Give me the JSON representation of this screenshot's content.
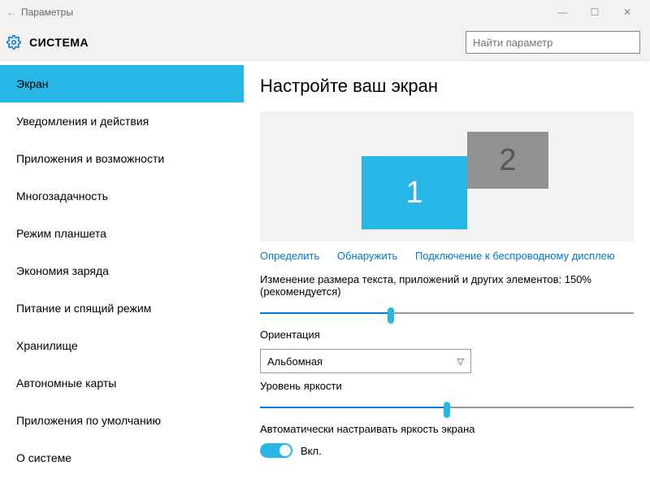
{
  "window": {
    "title": "Параметры",
    "back_icon": "←"
  },
  "header": {
    "title": "СИСТЕМА",
    "search_placeholder": "Найти параметр"
  },
  "sidebar": {
    "items": [
      {
        "label": "Экран",
        "selected": true
      },
      {
        "label": "Уведомления и действия"
      },
      {
        "label": "Приложения и возможности"
      },
      {
        "label": "Многозадачность"
      },
      {
        "label": "Режим планшета"
      },
      {
        "label": "Экономия заряда"
      },
      {
        "label": "Питание и спящий режим"
      },
      {
        "label": "Хранилище"
      },
      {
        "label": "Автономные карты"
      },
      {
        "label": "Приложения по умолчанию"
      },
      {
        "label": "О системе"
      }
    ]
  },
  "main": {
    "heading": "Настройте ваш экран",
    "monitors": {
      "m1": "1",
      "m2": "2"
    },
    "links": {
      "identify": "Определить",
      "detect": "Обнаружить",
      "connect": "Подключение к беспроводному дисплею"
    },
    "scale_label": "Изменение размера текста, приложений и других элементов: 150% (рекомендуется)",
    "orientation_label": "Ориентация",
    "orientation_value": "Альбомная",
    "brightness_label": "Уровень яркости",
    "auto_brightness_label": "Автоматически настраивать яркость экрана",
    "toggle_state": "Вкл."
  }
}
